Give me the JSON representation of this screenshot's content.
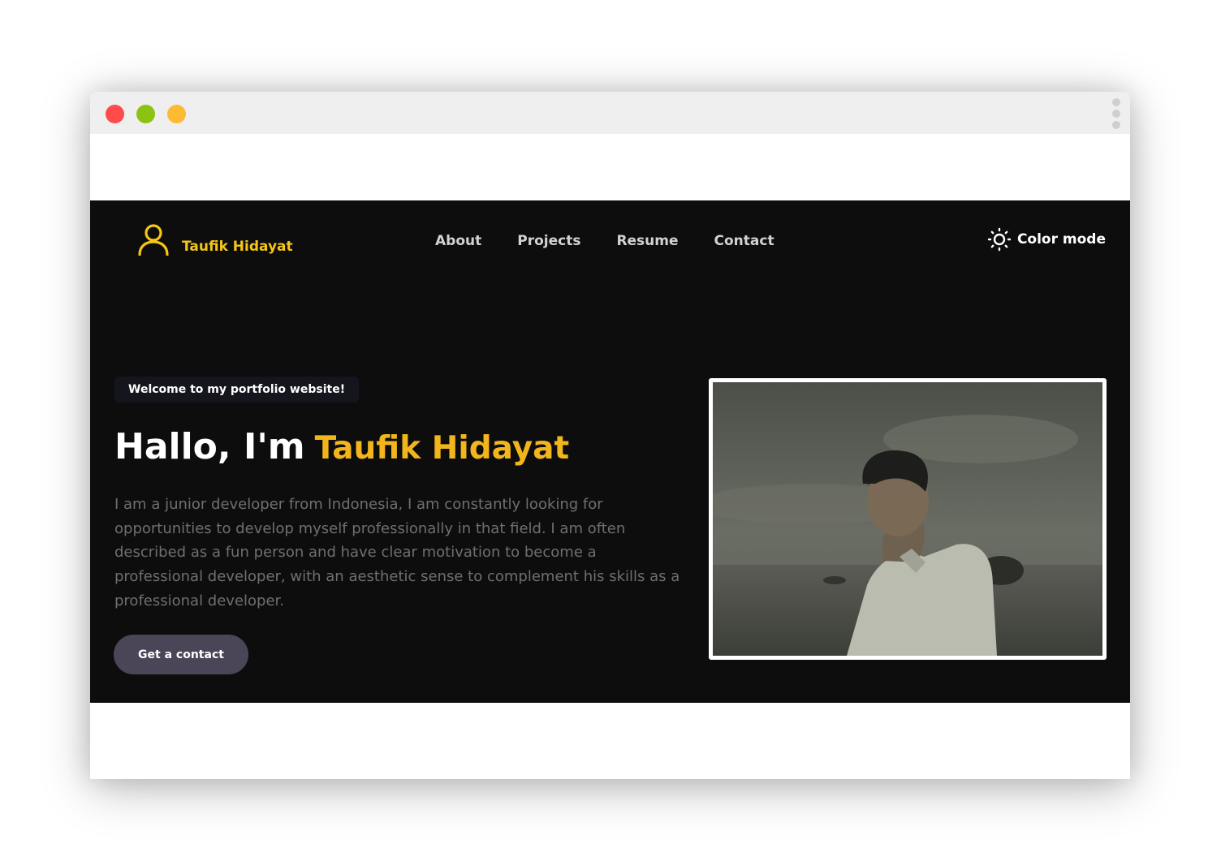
{
  "window": {
    "controls": [
      "close",
      "minimize",
      "maximize"
    ],
    "colors": {
      "close": "#ff4b4b",
      "minimize": "#8cc313",
      "maximize": "#fdbb34"
    }
  },
  "header": {
    "brand_name": "Taufik Hidayat",
    "brand_icon": "user-icon",
    "nav": [
      "About",
      "Projects",
      "Resume",
      "Contact"
    ],
    "color_mode_label": "Color mode",
    "color_mode_icon": "sun-icon"
  },
  "hero": {
    "badge": "Welcome to my portfolio website!",
    "greeting": "Hallo, I'm",
    "name": "Taufik Hidayat",
    "intro": "I am a junior developer from Indonesia, I am constantly looking for opportunities to develop myself professionally in that field. I am often described as a fun person and have clear motivation to become a professional developer, with an aesthetic sense to complement his skills as a professional developer.",
    "cta_label": "Get a contact",
    "photo_icon": "profile-photo"
  },
  "theme": {
    "background": "#0d0d0d",
    "accent": "#f2b61c",
    "button": "#4a4658"
  }
}
